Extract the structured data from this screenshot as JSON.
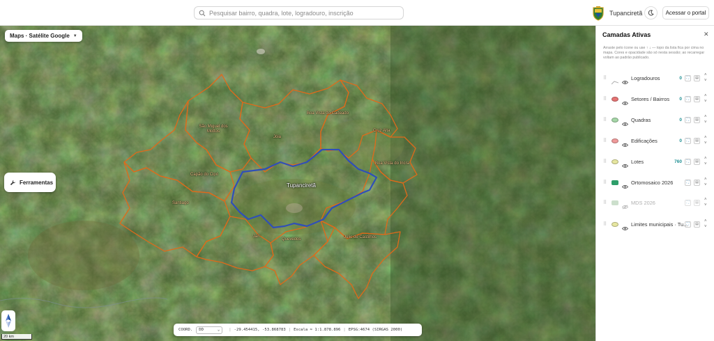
{
  "search": {
    "placeholder": "Pesquisar bairro, quadra, lote, logradouro, inscrição"
  },
  "header": {
    "municipality": "Tupanciretã",
    "portal_button": "Acessar o portal",
    "theme_icon": "moon-icon",
    "crest_icon": "crest-icon"
  },
  "map": {
    "basemap_label": "Maps · Satélite Google",
    "tools_label": "Ferramentas",
    "city_label": "Tupanciretã",
    "scale_label": "20 km",
    "places": [
      {
        "name": "São Miguel dos Mottos"
      },
      {
        "name": "Boa Vista do Cadeado"
      },
      {
        "name": "Jóia"
      },
      {
        "name": "Cruz Alta"
      },
      {
        "name": "Boa Vista do Incra"
      },
      {
        "name": "Capão do Cipó"
      },
      {
        "name": "Santiago"
      },
      {
        "name": "Jari"
      },
      {
        "name": "Quevedos"
      },
      {
        "name": "Júlio de Castilhos"
      }
    ],
    "colors": {
      "boundary_neighbors": "#e06a1a",
      "boundary_city": "#2f4fb8"
    }
  },
  "coords": {
    "label": "COORD.",
    "mode": "DD",
    "value": "-29.454415, -53.868783",
    "scale": "Escala ≈ 1:1.878.896",
    "crs": "EPSG:4674 (SIRGAS 2000)"
  },
  "panel": {
    "title": "Camadas Ativas",
    "hint": "Arraste pelo ícone ou use ↑ ↓ — topo da lista fica por cima no mapa. Cores e opacidade são só nesta sessão; ao recarregar voltam ao padrão publicado.",
    "layers": [
      {
        "name": "Logradouros",
        "count": "0",
        "symbol": "line",
        "color": "#b0b0b0",
        "visible": true,
        "has_search": true
      },
      {
        "name": "Setores / Bairros",
        "count": "0",
        "symbol": "fill",
        "color": "#e57373",
        "visible": true,
        "has_search": true
      },
      {
        "name": "Quadras",
        "count": "0",
        "symbol": "fill",
        "color": "#a5d6a7",
        "visible": true,
        "has_search": true
      },
      {
        "name": "Edificações",
        "count": "0",
        "symbol": "fill",
        "color": "#ef9a9a",
        "visible": true,
        "has_search": true
      },
      {
        "name": "Lotes",
        "count": "760",
        "symbol": "fill",
        "color": "#e6e6a0",
        "visible": true,
        "has_search": true
      },
      {
        "name": "Ortomosaico 2026",
        "count": "",
        "symbol": "raster",
        "color": "#2e9e6a",
        "visible": true,
        "has_search": false
      },
      {
        "name": "MDS 2026",
        "count": "",
        "symbol": "raster",
        "color": "#7fb07f",
        "visible": false,
        "has_search": false
      },
      {
        "name": "Limites municipais · Tu...",
        "count": "",
        "symbol": "fill",
        "color": "#e6e6a0",
        "visible": true,
        "has_search": false
      }
    ]
  }
}
